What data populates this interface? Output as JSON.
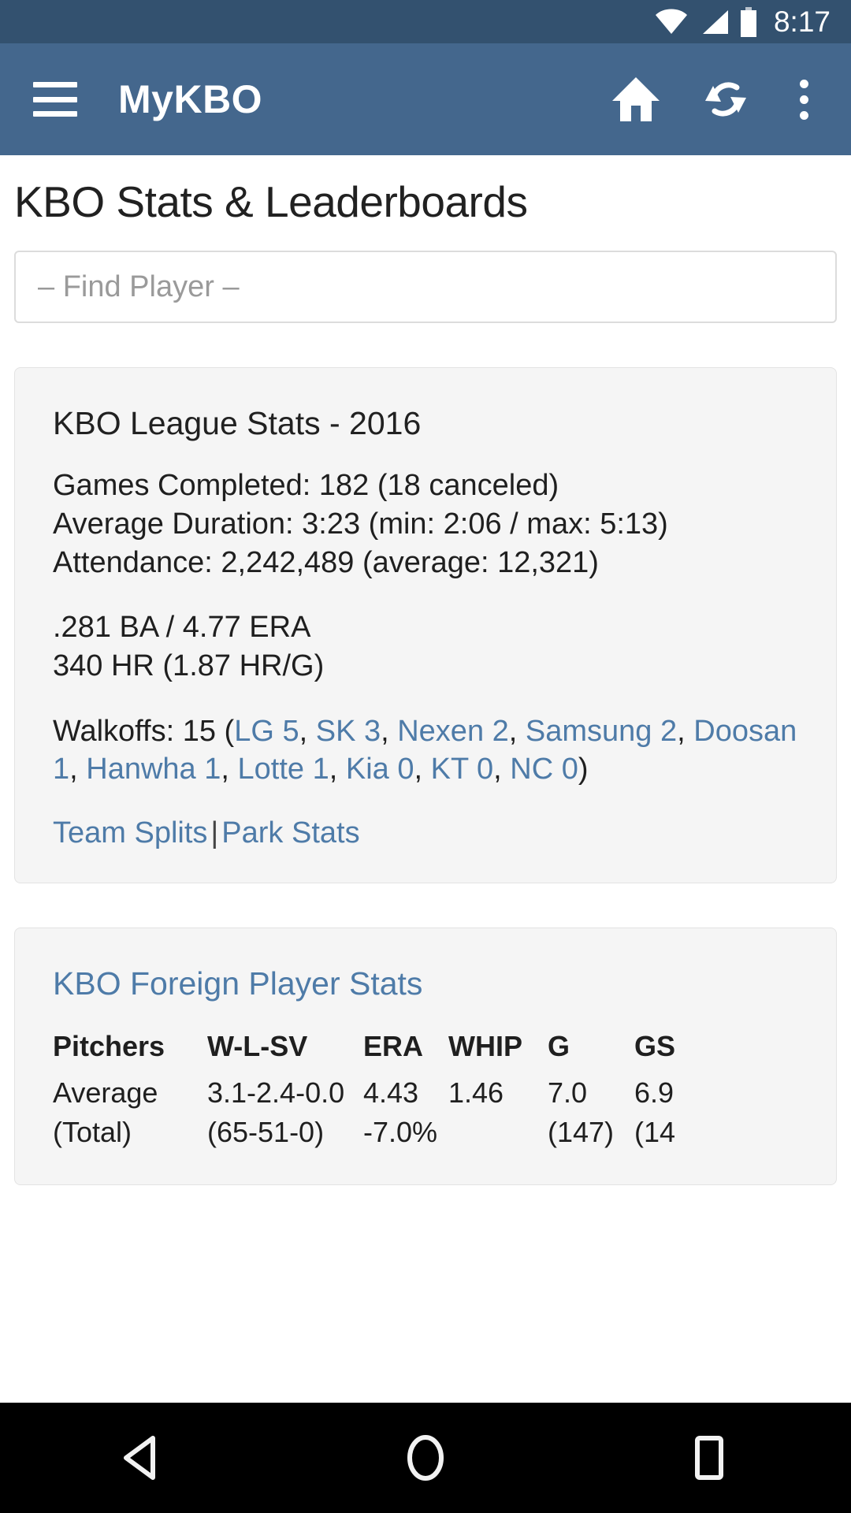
{
  "statusbar": {
    "time": "8:17",
    "icons": [
      "wifi-icon",
      "signal-icon",
      "battery-icon"
    ]
  },
  "appbar": {
    "title": "MyKBO",
    "menu_icon": "hamburger-menu-icon",
    "home_icon": "home-icon",
    "refresh_icon": "refresh-icon",
    "overflow_icon": "overflow-menu-icon",
    "background_color": "#44678d"
  },
  "page": {
    "title": "KBO Stats & Leaderboards"
  },
  "search": {
    "value": "",
    "placeholder": "– Find Player –"
  },
  "league_card": {
    "title": "KBO League Stats - 2016",
    "lines": [
      "Games Completed: 182 (18 canceled)",
      "Average Duration: 3:23 (min: 2:06 / max: 5:13)",
      "Attendance: 2,242,489 (average: 12,321)"
    ],
    "rate_lines": [
      ".281 BA / 4.77 ERA",
      "340 HR (1.87 HR/G)"
    ],
    "walkoffs": {
      "prefix": "Walkoffs: 15 (",
      "suffix": ")",
      "teams": [
        "LG 5",
        "SK 3",
        "Nexen 2",
        "Samsung 2",
        "Doosan 1",
        "Hanwha 1",
        "Lotte 1",
        "Kia 0",
        "KT 0",
        "NC 0"
      ]
    },
    "links": {
      "team_splits": "Team Splits",
      "separator": "|",
      "park_stats": "Park Stats"
    }
  },
  "foreign_card": {
    "title": "KBO Foreign Player Stats",
    "table": {
      "headers": [
        "Pitchers",
        "W-L-SV",
        "ERA",
        "WHIP",
        "G",
        "GS"
      ],
      "rows": [
        [
          "Average",
          "3.1-2.4-0.0",
          "4.43",
          "1.46",
          "7.0",
          "6.9"
        ],
        [
          "(Total)",
          "(65-51-0)",
          "-7.0%",
          "",
          "(147)",
          "(14"
        ]
      ]
    }
  },
  "navbar": {
    "back_icon": "back-triangle-icon",
    "home_icon": "home-circle-icon",
    "recents_icon": "recents-square-icon"
  },
  "colors": {
    "status_bar": "#33516f",
    "app_bar": "#44678d",
    "link": "#4e7ba8",
    "card_bg": "#f5f5f5",
    "nav_bg": "#000000"
  }
}
